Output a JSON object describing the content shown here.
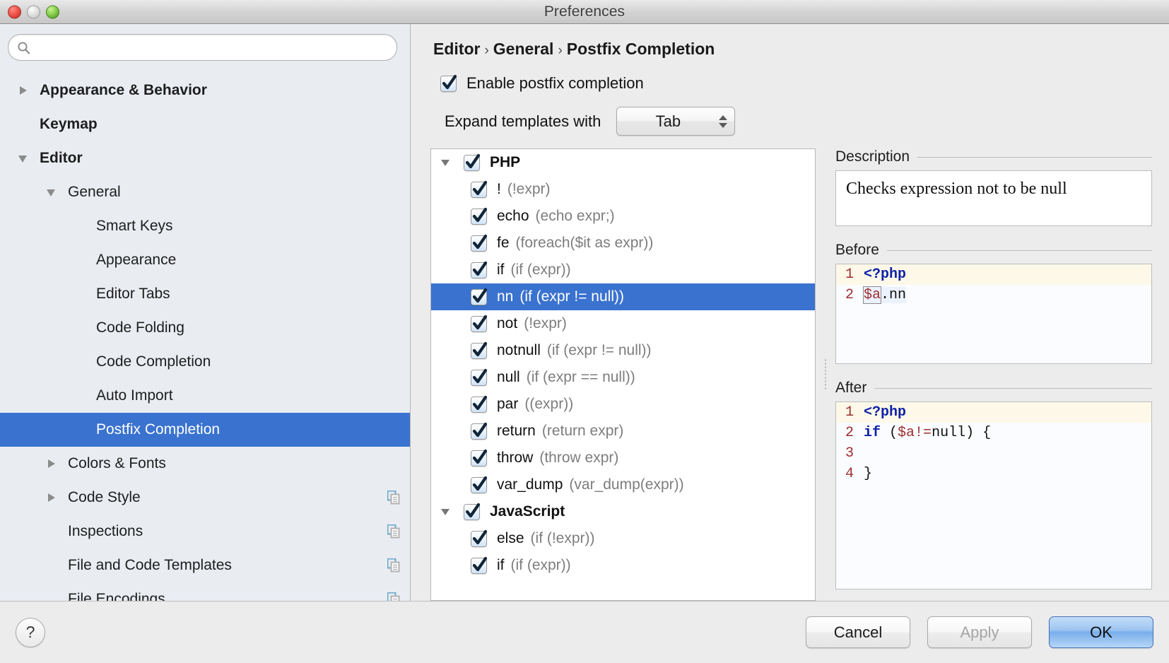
{
  "window": {
    "title": "Preferences",
    "controls": {
      "close": "close-button",
      "minimize": "minimize-button",
      "zoom": "zoom-button"
    }
  },
  "search": {
    "value": "",
    "placeholder": ""
  },
  "sidebar": {
    "items": [
      {
        "label": "Appearance & Behavior",
        "indent": 0,
        "arrow": "right",
        "bold": true,
        "selected": false,
        "badge": false
      },
      {
        "label": "Keymap",
        "indent": 0,
        "arrow": "none",
        "bold": true,
        "selected": false,
        "badge": false
      },
      {
        "label": "Editor",
        "indent": 0,
        "arrow": "down",
        "bold": true,
        "selected": false,
        "badge": false
      },
      {
        "label": "General",
        "indent": 1,
        "arrow": "down",
        "bold": false,
        "selected": false,
        "badge": false
      },
      {
        "label": "Smart Keys",
        "indent": 2,
        "arrow": "none",
        "bold": false,
        "selected": false,
        "badge": false
      },
      {
        "label": "Appearance",
        "indent": 2,
        "arrow": "none",
        "bold": false,
        "selected": false,
        "badge": false
      },
      {
        "label": "Editor Tabs",
        "indent": 2,
        "arrow": "none",
        "bold": false,
        "selected": false,
        "badge": false
      },
      {
        "label": "Code Folding",
        "indent": 2,
        "arrow": "none",
        "bold": false,
        "selected": false,
        "badge": false
      },
      {
        "label": "Code Completion",
        "indent": 2,
        "arrow": "none",
        "bold": false,
        "selected": false,
        "badge": false
      },
      {
        "label": "Auto Import",
        "indent": 2,
        "arrow": "none",
        "bold": false,
        "selected": false,
        "badge": false
      },
      {
        "label": "Postfix Completion",
        "indent": 2,
        "arrow": "none",
        "bold": false,
        "selected": true,
        "badge": false
      },
      {
        "label": "Colors & Fonts",
        "indent": 1,
        "arrow": "right",
        "bold": false,
        "selected": false,
        "badge": false
      },
      {
        "label": "Code Style",
        "indent": 1,
        "arrow": "right",
        "bold": false,
        "selected": false,
        "badge": true
      },
      {
        "label": "Inspections",
        "indent": 1,
        "arrow": "none",
        "bold": false,
        "selected": false,
        "badge": true
      },
      {
        "label": "File and Code Templates",
        "indent": 1,
        "arrow": "none",
        "bold": false,
        "selected": false,
        "badge": true
      },
      {
        "label": "File Encodings",
        "indent": 1,
        "arrow": "none",
        "bold": false,
        "selected": false,
        "badge": true
      }
    ]
  },
  "main": {
    "breadcrumb": [
      "Editor",
      "General",
      "Postfix Completion"
    ],
    "breadcrumb_separator": "›",
    "enable_checkbox": {
      "label": "Enable postfix completion",
      "checked": true
    },
    "expand_with": {
      "label": "Expand templates with",
      "value": "Tab"
    }
  },
  "templates": {
    "rows": [
      {
        "kind": "group",
        "arrow": "down",
        "checked": true,
        "name": "PHP",
        "desc": "",
        "selected": false
      },
      {
        "kind": "child",
        "arrow": "none",
        "checked": true,
        "name": "!",
        "desc": "(!expr)",
        "selected": false
      },
      {
        "kind": "child",
        "arrow": "none",
        "checked": true,
        "name": "echo",
        "desc": "(echo expr;)",
        "selected": false
      },
      {
        "kind": "child",
        "arrow": "none",
        "checked": true,
        "name": "fe",
        "desc": "(foreach($it as expr))",
        "selected": false
      },
      {
        "kind": "child",
        "arrow": "none",
        "checked": true,
        "name": "if",
        "desc": "(if (expr))",
        "selected": false
      },
      {
        "kind": "child",
        "arrow": "none",
        "checked": true,
        "name": "nn",
        "desc": "(if (expr != null))",
        "selected": true
      },
      {
        "kind": "child",
        "arrow": "none",
        "checked": true,
        "name": "not",
        "desc": "(!expr)",
        "selected": false
      },
      {
        "kind": "child",
        "arrow": "none",
        "checked": true,
        "name": "notnull",
        "desc": "(if (expr != null))",
        "selected": false
      },
      {
        "kind": "child",
        "arrow": "none",
        "checked": true,
        "name": "null",
        "desc": "(if (expr == null))",
        "selected": false
      },
      {
        "kind": "child",
        "arrow": "none",
        "checked": true,
        "name": "par",
        "desc": "((expr))",
        "selected": false
      },
      {
        "kind": "child",
        "arrow": "none",
        "checked": true,
        "name": "return",
        "desc": "(return expr)",
        "selected": false
      },
      {
        "kind": "child",
        "arrow": "none",
        "checked": true,
        "name": "throw",
        "desc": "(throw expr)",
        "selected": false
      },
      {
        "kind": "child",
        "arrow": "none",
        "checked": true,
        "name": "var_dump",
        "desc": "(var_dump(expr))",
        "selected": false
      },
      {
        "kind": "group",
        "arrow": "down",
        "checked": true,
        "name": "JavaScript",
        "desc": "",
        "selected": false
      },
      {
        "kind": "child",
        "arrow": "none",
        "checked": true,
        "name": "else",
        "desc": "(if (!expr))",
        "selected": false
      },
      {
        "kind": "child",
        "arrow": "none",
        "checked": true,
        "name": "if",
        "desc": "(if (expr))",
        "selected": false
      }
    ]
  },
  "detail": {
    "description": {
      "title": "Description",
      "text": "Checks expression not to be null"
    },
    "before": {
      "title": "Before",
      "lines": [
        {
          "num": "1",
          "highlight": true,
          "tokens": [
            {
              "t": "<?php",
              "c": "tok-php"
            }
          ]
        },
        {
          "num": "2",
          "highlight": false,
          "tokens": [
            {
              "t": "$a",
              "c": "tok-var tok-boxed"
            },
            {
              "t": ".nn",
              "c": "tok-plain tok-sel"
            }
          ]
        },
        {
          "num": "",
          "highlight": false,
          "tokens": []
        },
        {
          "num": "",
          "highlight": false,
          "tokens": []
        }
      ]
    },
    "after": {
      "title": "After",
      "lines": [
        {
          "num": "1",
          "highlight": true,
          "tokens": [
            {
              "t": "<?php",
              "c": "tok-php"
            }
          ]
        },
        {
          "num": "2",
          "highlight": false,
          "tokens": [
            {
              "t": "if",
              "c": "tok-kw"
            },
            {
              "t": " (",
              "c": "tok-plain"
            },
            {
              "t": "$a",
              "c": "tok-var"
            },
            {
              "t": "!=",
              "c": "tok-var"
            },
            {
              "t": "null",
              "c": "tok-plain"
            },
            {
              "t": ") {",
              "c": "tok-plain"
            }
          ]
        },
        {
          "num": "3",
          "highlight": false,
          "tokens": []
        },
        {
          "num": "4",
          "highlight": false,
          "tokens": [
            {
              "t": "}",
              "c": "tok-plain"
            }
          ]
        }
      ]
    }
  },
  "footer": {
    "help": "?",
    "cancel": "Cancel",
    "apply": "Apply",
    "ok": "OK"
  },
  "colors": {
    "selection_blue": "#3a72cf",
    "sidebar_bg": "#e9edf2",
    "panel_bg": "#ececec",
    "code_highlight": "#fdf8e8",
    "keyword_blue": "#0f22a8",
    "variable_red": "#9d2f2f"
  }
}
